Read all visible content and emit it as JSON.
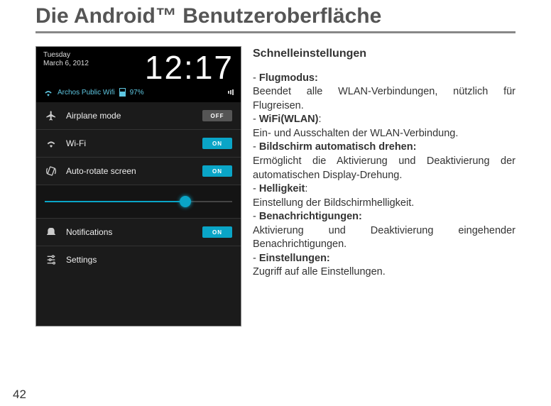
{
  "title": "Die Android™ Benutzeroberfläche",
  "page_number": "42",
  "phone": {
    "day": "Tuesday",
    "date": "March 6, 2012",
    "time": "12:17",
    "ssid": "Archos Public Wifi",
    "battery": "97%",
    "items": [
      {
        "label": "Airplane mode",
        "state": "OFF"
      },
      {
        "label": "Wi-Fi",
        "state": "ON"
      },
      {
        "label": "Auto-rotate screen",
        "state": "ON"
      },
      {
        "label": "Notifications",
        "state": "ON"
      },
      {
        "label": "Settings"
      }
    ]
  },
  "desc": {
    "heading": "Schnelleinstellungen",
    "s0": {
      "t": "Flugmodus:",
      "d": "Beendet alle WLAN-Verbindungen, nützlich für Flugreisen."
    },
    "s1": {
      "t": "WiFi(WLAN)",
      "d": "Ein- und  Ausschalten der WLAN-Verbindung."
    },
    "s2": {
      "t": "Bildschirm automatisch drehen:",
      "d": "Ermöglicht die Aktivierung und Deaktivierung der automatischen Display-Drehung."
    },
    "s3": {
      "t": "Helligkeit",
      "d": "Einstellung der Bildschirmhelligkeit."
    },
    "s4": {
      "t": "Benachrichtigungen:",
      "d": "Aktivierung und Deaktivierung eingehender Benachrichtigungen."
    },
    "s5": {
      "t": "Einstellungen:",
      "d": "Zugriff auf alle Einstellungen."
    }
  }
}
